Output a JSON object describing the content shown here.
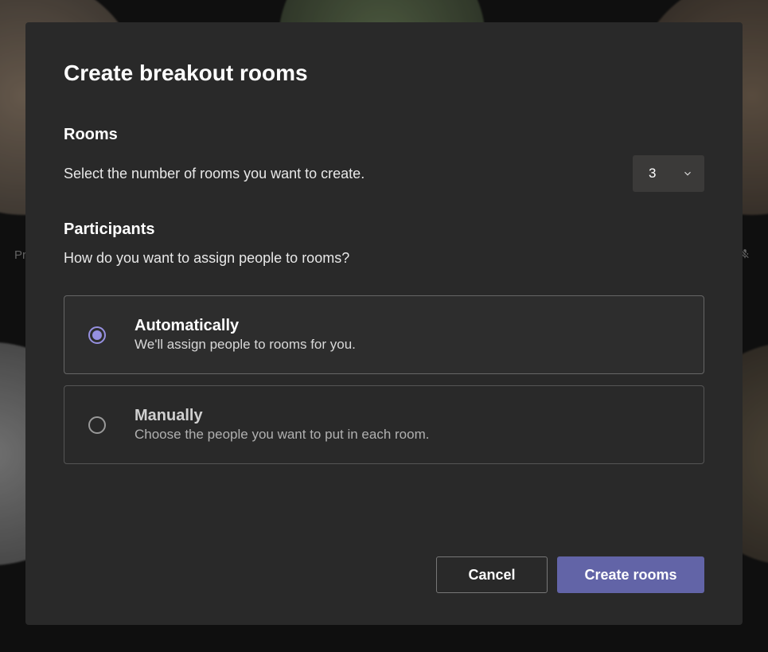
{
  "dialog": {
    "title": "Create breakout rooms",
    "rooms": {
      "heading": "Rooms",
      "description": "Select the number of rooms you want to create.",
      "selected_value": "3"
    },
    "participants": {
      "heading": "Participants",
      "description": "How do you want to assign people to rooms?",
      "options": [
        {
          "title": "Automatically",
          "subtitle": "We'll assign people to rooms for you.",
          "selected": true
        },
        {
          "title": "Manually",
          "subtitle": "Choose the people you want to put in each room.",
          "selected": false
        }
      ]
    },
    "footer": {
      "cancel_label": "Cancel",
      "create_label": "Create rooms"
    }
  },
  "background": {
    "partial_name": "Pr"
  }
}
